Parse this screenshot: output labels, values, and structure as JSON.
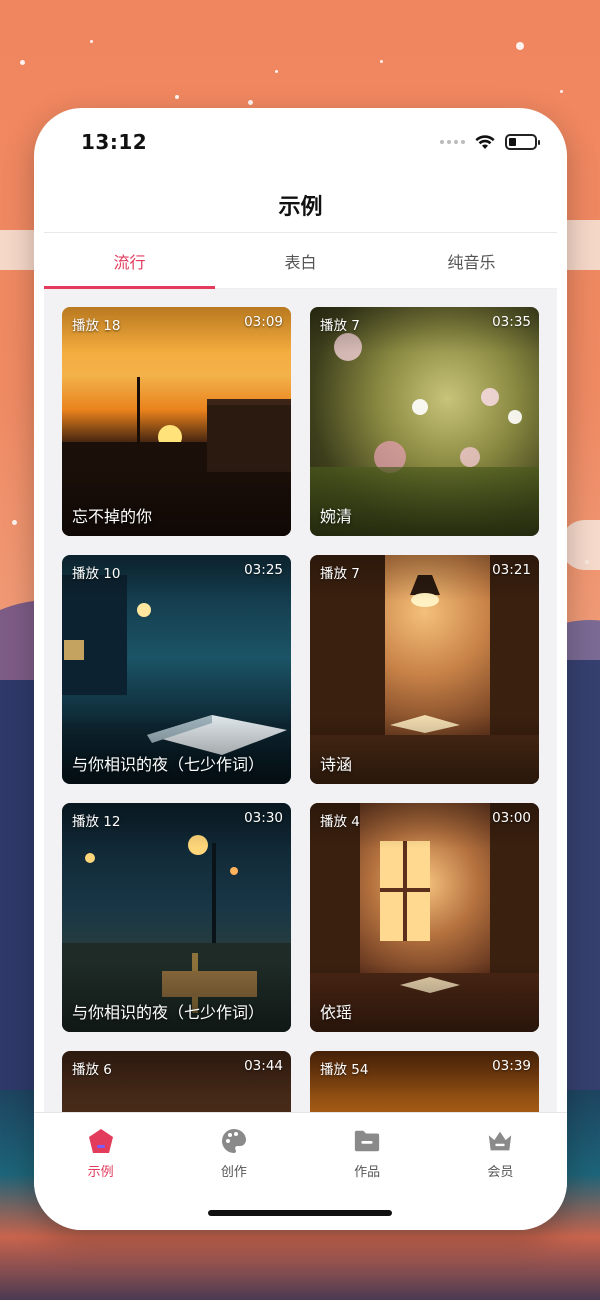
{
  "status_bar": {
    "time": "13:12"
  },
  "header": {
    "title": "示例"
  },
  "tabs": [
    {
      "label": "流行",
      "active": true
    },
    {
      "label": "表白",
      "active": false
    },
    {
      "label": "纯音乐",
      "active": false
    }
  ],
  "cards": [
    {
      "plays": "播放 18",
      "duration": "03:09",
      "name": "忘不掉的你"
    },
    {
      "plays": "播放 7",
      "duration": "03:35",
      "name": "婉清"
    },
    {
      "plays": "播放 10",
      "duration": "03:25",
      "name": "与你相识的夜（七少作词）"
    },
    {
      "plays": "播放 7",
      "duration": "03:21",
      "name": "诗涵"
    },
    {
      "plays": "播放 12",
      "duration": "03:30",
      "name": "与你相识的夜（七少作词）"
    },
    {
      "plays": "播放 4",
      "duration": "03:00",
      "name": "依瑶"
    },
    {
      "plays": "播放 6",
      "duration": "03:44",
      "name": ""
    },
    {
      "plays": "播放 54",
      "duration": "03:39",
      "name": ""
    }
  ],
  "nav": [
    {
      "label": "示例",
      "icon": "home-icon",
      "active": true
    },
    {
      "label": "创作",
      "icon": "palette-icon",
      "active": false
    },
    {
      "label": "作品",
      "icon": "folder-icon",
      "active": false
    },
    {
      "label": "会员",
      "icon": "crown-icon",
      "active": false
    }
  ],
  "colors": {
    "accent": "#e23b5c",
    "inactive_icon": "#8a8a8a"
  }
}
